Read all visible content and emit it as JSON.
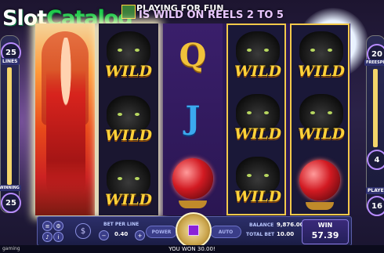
{
  "header": {
    "logo_slot": "Slot",
    "logo_catalog": "Catalog",
    "playing_for_fun": "PLAYING FOR FUN",
    "banner_text": "IS WILD ON REELS 2 TO 5"
  },
  "left_panel": {
    "lines_value": "25",
    "lines_label": "LINES",
    "winning_label": "WINNING",
    "winning_value": "25"
  },
  "right_panel": {
    "freespins_value": "20",
    "freespins_label": "FREESPINS",
    "mid_value": "4",
    "played_label": "PLAYED",
    "played_value": "16"
  },
  "reels": {
    "reel1": "fairy",
    "reel2": [
      "WILD",
      "WILD",
      "WILD"
    ],
    "reel3": [
      "Q",
      "J",
      "orb"
    ],
    "reel4": [
      "WILD",
      "WILD",
      "WILD"
    ],
    "reel5": [
      "WILD",
      "WILD",
      "orb"
    ],
    "symbol_q": "Q",
    "symbol_j": "J",
    "wild_text": "WILD"
  },
  "controls": {
    "bet_per_line_label": "BET PER LINE",
    "bet_per_line_value": "0.40",
    "power_label": "POWER",
    "auto_label": "AUTO",
    "balance_label": "BALANCE",
    "balance_value": "9,876.00",
    "total_bet_label": "TOTAL BET",
    "total_bet_value": "10.00",
    "win_label": "WIN",
    "win_value": "57.39",
    "coin_symbol": "$"
  },
  "footer": {
    "won_text": "YOU WON 30.00!",
    "brand": "gaming"
  },
  "colors": {
    "gold": "#f3c94a",
    "panel": "#2c2f6a",
    "accent_purple": "#8a22d8"
  }
}
